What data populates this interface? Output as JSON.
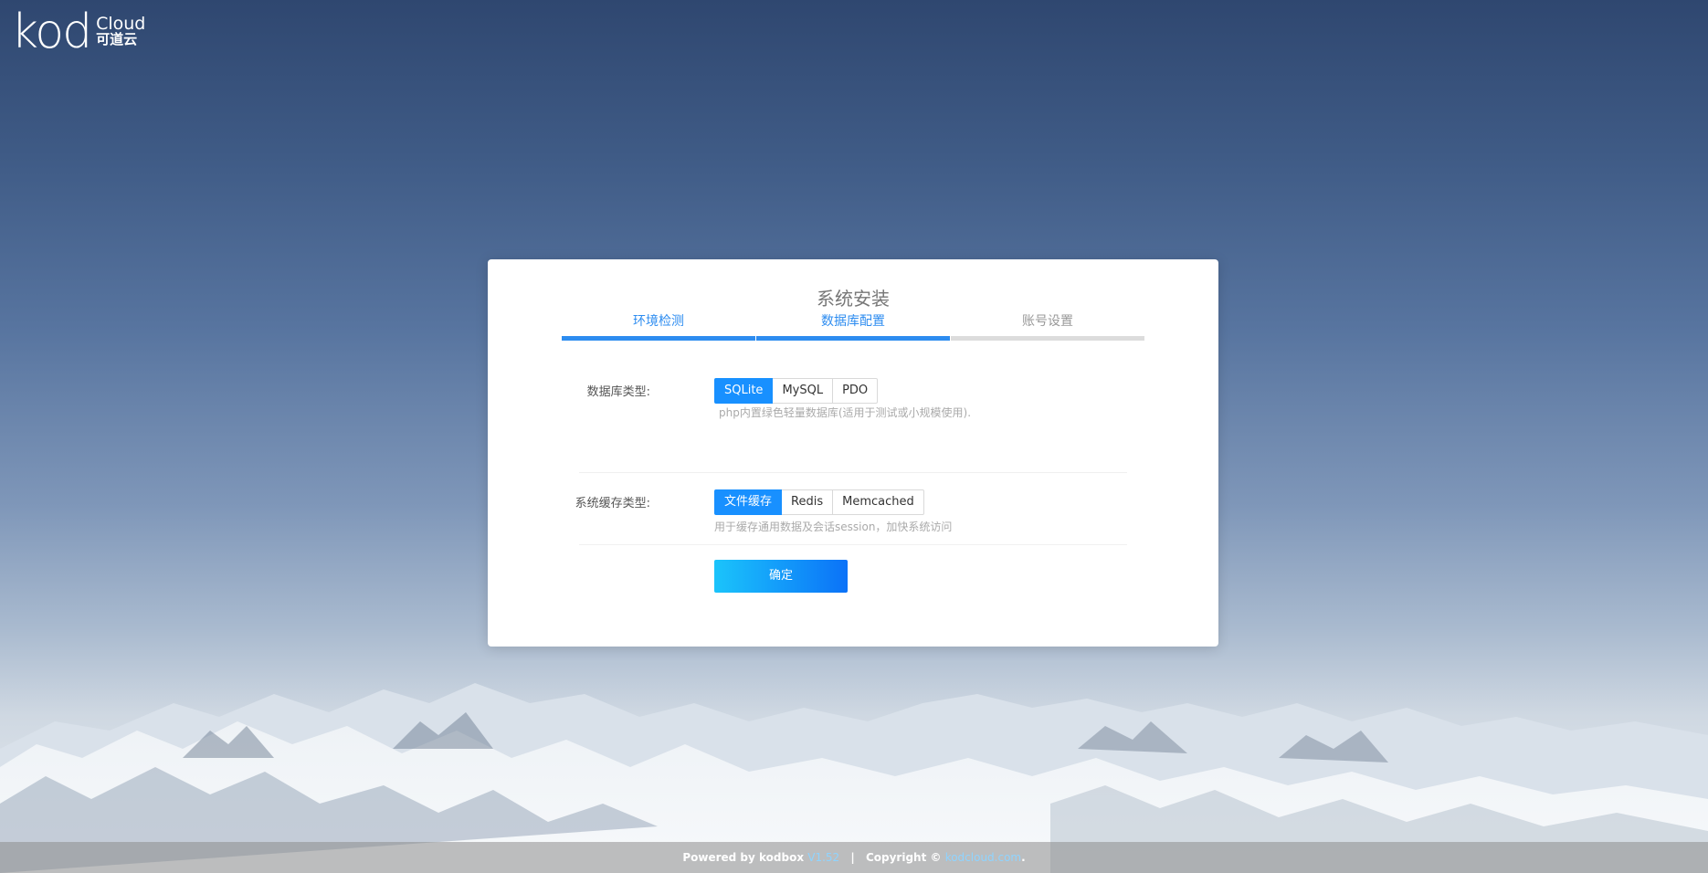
{
  "logo": {
    "text": "kod",
    "cloud": "Cloud",
    "cn": "可道云"
  },
  "install": {
    "title": "系统安装",
    "steps": [
      {
        "label": "环境检测",
        "state": "done"
      },
      {
        "label": "数据库配置",
        "state": "done"
      },
      {
        "label": "账号设置",
        "state": "todo"
      }
    ]
  },
  "form": {
    "db_type": {
      "label": "数据库类型:",
      "options": [
        "SQLite",
        "MySQL",
        "PDO"
      ],
      "selected": "SQLite",
      "hint": "php内置绿色轻量数据库(适用于测试或小规模使用)."
    },
    "cache_type": {
      "label": "系统缓存类型:",
      "options": [
        "文件缓存",
        "Redis",
        "Memcached"
      ],
      "selected": "文件缓存",
      "hint": "用于缓存通用数据及会话session，加快系统访问"
    },
    "confirm_label": "确定"
  },
  "footer": {
    "powered": "Powered by kodbox",
    "version": "V1.52",
    "separator": "|",
    "copyright": "Copyright ©",
    "site": "kodcloud.com",
    "end": "."
  },
  "colors": {
    "accent": "#1890ff",
    "step_done": "#2d8cf0",
    "step_todo": "#dcdcdc"
  }
}
